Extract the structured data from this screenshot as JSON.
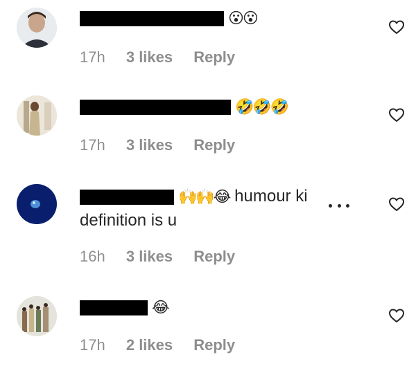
{
  "comments": [
    {
      "emoji": "😮😮",
      "text": "",
      "time": "17h",
      "likes": "3 likes",
      "reply": "Reply"
    },
    {
      "emoji": "🤣🤣🤣",
      "text": "",
      "time": "17h",
      "likes": "3 likes",
      "reply": "Reply"
    },
    {
      "emoji": "🙌🙌😂",
      "text": "humour ki",
      "text2": "definition is u",
      "time": "16h",
      "likes": "3 likes",
      "reply": "Reply"
    },
    {
      "emoji": "😂",
      "text": "",
      "time": "17h",
      "likes": "2 likes",
      "reply": "Reply"
    }
  ],
  "icons": {
    "like": "heart-outline-icon",
    "more": "more-dots-icon"
  },
  "colors": {
    "text": "#262626",
    "meta": "#8e8e8e",
    "redaction": "#000000"
  }
}
